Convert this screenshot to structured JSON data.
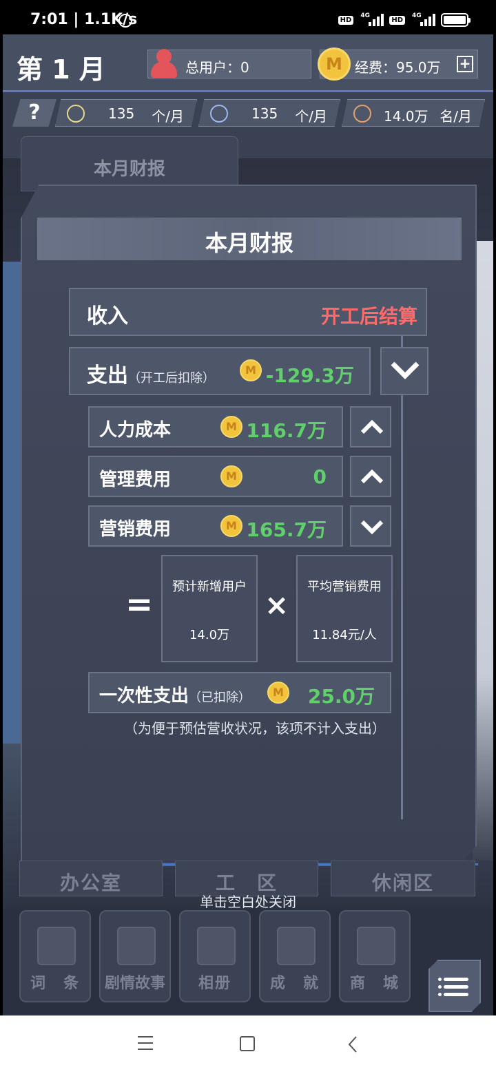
{
  "status_bar": {
    "time": "7:01",
    "speed": "1.1K/s",
    "hd1": "HD",
    "hd2": "HD",
    "net1": "4G",
    "net2": "4G"
  },
  "header": {
    "month": "第 1 月",
    "users_label": "总用户：0",
    "funds_label": "经费：95.0万",
    "coin_symbol": "M"
  },
  "resources": [
    {
      "icon": "lightbulb-icon",
      "value": "135",
      "unit": "个/月"
    },
    {
      "icon": "wrench-icon",
      "value": "135",
      "unit": "个/月"
    },
    {
      "icon": "person-icon",
      "value": "14.0万",
      "unit": "名/月"
    }
  ],
  "help_label": "?",
  "back_tab_label": "本月财报",
  "panel": {
    "title": "本月财报",
    "income": {
      "label": "收入",
      "value": "开工后结算"
    },
    "expense": {
      "label": "支出",
      "sub": "（开工后扣除）",
      "value": "-129.3万"
    },
    "items": [
      {
        "label": "人力成本",
        "value": "116.7万",
        "chevron": "up"
      },
      {
        "label": "管理费用",
        "value": "0",
        "chevron": "up"
      },
      {
        "label": "营销费用",
        "value": "165.7万",
        "chevron": "down"
      }
    ],
    "calc": {
      "equals": "=",
      "times": "×",
      "box1_title": "预计新增用户",
      "box1_value": "14.0万",
      "box2_title": "平均营销费用",
      "box2_value": "11.84元/人"
    },
    "one_time": {
      "label": "一次性支出",
      "sub": "（已扣除）",
      "value": "25.0万"
    },
    "note": "（为便于预估营收状况，该项不计入支出）"
  },
  "zones": [
    "办公室",
    "工　区",
    "休闲区"
  ],
  "close_hint": "单击空白处关闭",
  "dock": [
    "词　条",
    "剧情故事",
    "相册",
    "成　就",
    "商　城"
  ],
  "colors": {
    "green": "#5fd06a",
    "red": "#ff6a6a",
    "coin": "#f2c33d",
    "accent_blue": "#5e7bb8"
  }
}
